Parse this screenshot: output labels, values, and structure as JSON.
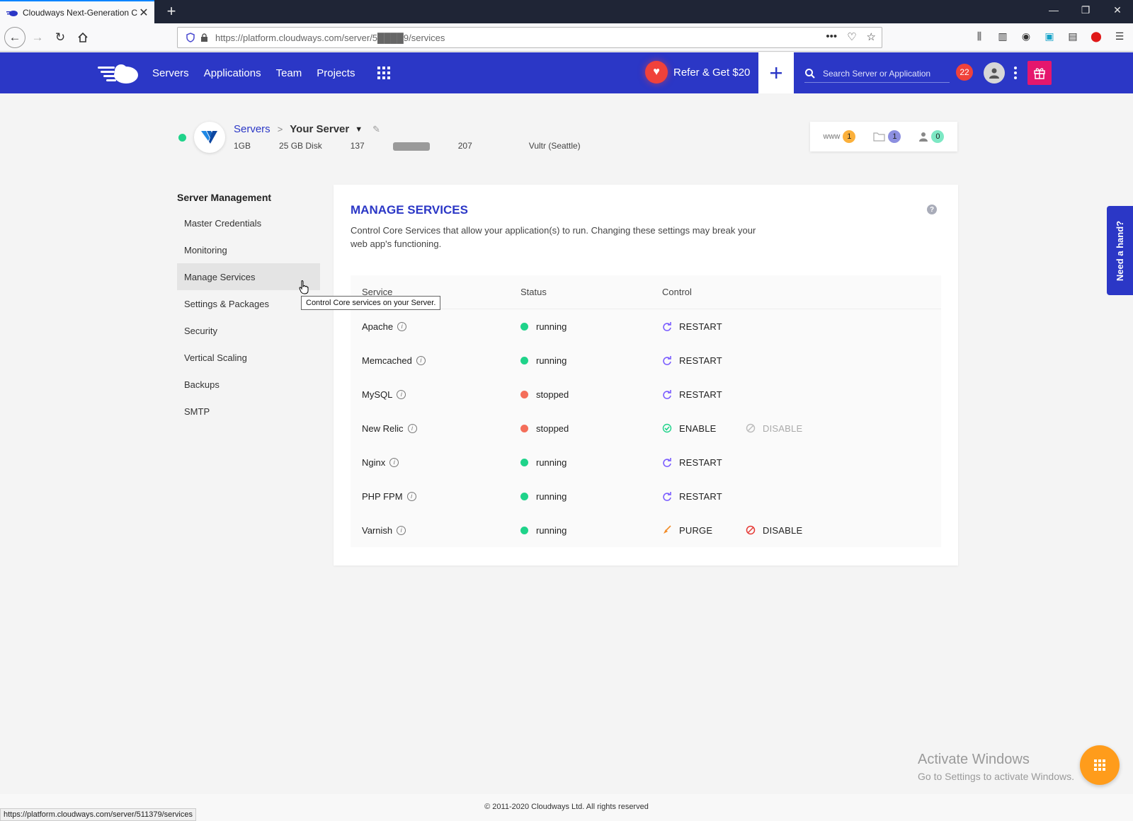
{
  "browser": {
    "tab_title": "Cloudways Next-Generation Cl",
    "url": "https://platform.cloudways.com/server/5████9/services",
    "status_url": "https://platform.cloudways.com/server/511379/services"
  },
  "header": {
    "nav": [
      "Servers",
      "Applications",
      "Team",
      "Projects"
    ],
    "refer": "Refer & Get $20",
    "search_placeholder": "Search Server or Application",
    "notifications": "22"
  },
  "server": {
    "breadcrumb_root": "Servers",
    "name": "Your Server",
    "size": "1GB",
    "disk": "25 GB Disk",
    "ip_prefix": "137",
    "ip_suffix": "207",
    "provider": "Vultr (Seattle)",
    "counts": {
      "www": "1",
      "files": "1",
      "users": "0"
    }
  },
  "sidebar": {
    "title": "Server Management",
    "items": [
      "Master Credentials",
      "Monitoring",
      "Manage Services",
      "Settings & Packages",
      "Security",
      "Vertical Scaling",
      "Backups",
      "SMTP"
    ],
    "tooltip": "Control Core services on your Server."
  },
  "main": {
    "title": "MANAGE SERVICES",
    "description": "Control Core Services that allow your application(s) to run. Changing these settings may break your web app's functioning.",
    "columns": [
      "Service",
      "Status",
      "Control"
    ],
    "services": [
      {
        "name": "Apache",
        "status": "running",
        "control1": "RESTART",
        "control2": ""
      },
      {
        "name": "Memcached",
        "status": "running",
        "control1": "RESTART",
        "control2": ""
      },
      {
        "name": "MySQL",
        "status": "stopped",
        "control1": "RESTART",
        "control2": ""
      },
      {
        "name": "New Relic",
        "status": "stopped",
        "control1": "ENABLE",
        "control2": "DISABLE"
      },
      {
        "name": "Nginx",
        "status": "running",
        "control1": "RESTART",
        "control2": ""
      },
      {
        "name": "PHP FPM",
        "status": "running",
        "control1": "RESTART",
        "control2": ""
      },
      {
        "name": "Varnish",
        "status": "running",
        "control1": "PURGE",
        "control2": "DISABLE"
      }
    ]
  },
  "need_hand": "Need a hand?",
  "windows": {
    "line1": "Activate Windows",
    "line2": "Go to Settings to activate Windows."
  },
  "footer": "© 2011-2020 Cloudways Ltd. All rights reserved",
  "colors": {
    "brand": "#2b37c6",
    "running": "#1fd38a",
    "stopped": "#f46e5a",
    "gift": "#e5176d",
    "fab": "#ff9c1b"
  }
}
